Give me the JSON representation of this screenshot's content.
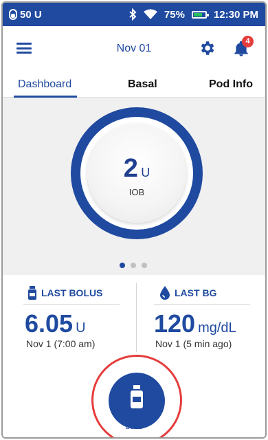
{
  "status_bar": {
    "pod_insulin": "50 U",
    "battery_percent": "75%",
    "battery_level": 0.75,
    "time": "12:30 PM"
  },
  "header": {
    "date": "Nov 01",
    "notification_count": "4"
  },
  "tabs": [
    {
      "label": "Dashboard",
      "active": true
    },
    {
      "label": "Basal",
      "active": false
    },
    {
      "label": "Pod Info",
      "active": false
    }
  ],
  "iob": {
    "value": "2",
    "unit": "U",
    "label": "IOB"
  },
  "page_dots": {
    "count": 3,
    "active_index": 0
  },
  "last_bolus": {
    "title": "LAST BOLUS",
    "value": "6.05",
    "unit": "U",
    "time": "Nov 1 (7:00 am)"
  },
  "last_bg": {
    "title": "LAST BG",
    "value": "120",
    "unit": "mg/dL",
    "time": "Nov 1 (5 min ago)"
  },
  "bolus_button": {
    "label": "Bolus"
  },
  "colors": {
    "primary": "#1f4aa0",
    "battery_fill": "#26c05a",
    "alert_red": "#e53c3c"
  }
}
